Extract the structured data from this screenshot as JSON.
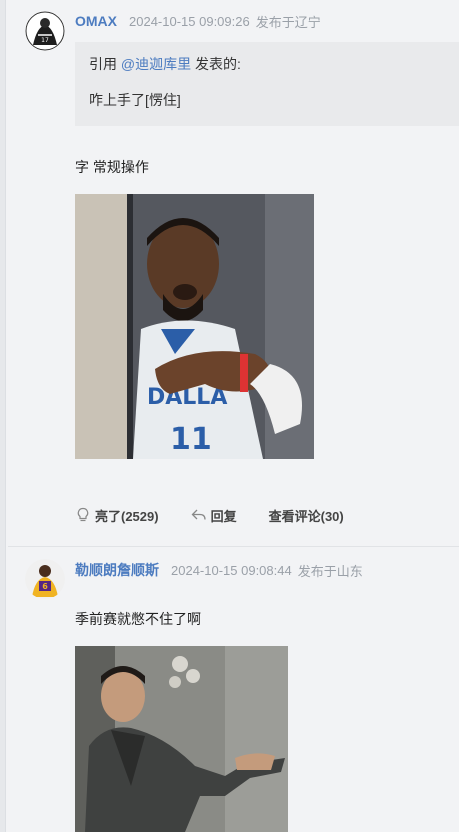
{
  "post1": {
    "username": "OMAX",
    "time": "2024-10-15 09:09:26",
    "location": "发布于辽宁",
    "quote": {
      "prefix": "引用 ",
      "mention": "@迪迦库里",
      "suffix": " 发表的:",
      "text": "咋上手了[愣住]"
    },
    "reply_text": "字 常规操作",
    "actions": {
      "like": "亮了(2529)",
      "reply": "回复",
      "view_comments": "查看评论(30)"
    }
  },
  "post2": {
    "username": "勒顺朗詹顺斯",
    "time": "2024-10-15 09:08:44",
    "location": "发布于山东",
    "reply_text": "季前赛就憋不住了啊"
  },
  "icons": {
    "like": "lightbulb-icon",
    "reply": "reply-arrow-icon"
  },
  "colors": {
    "username": "#4d7cc0",
    "background": "#f2f3f5",
    "quote_bg": "#e9eaec"
  }
}
